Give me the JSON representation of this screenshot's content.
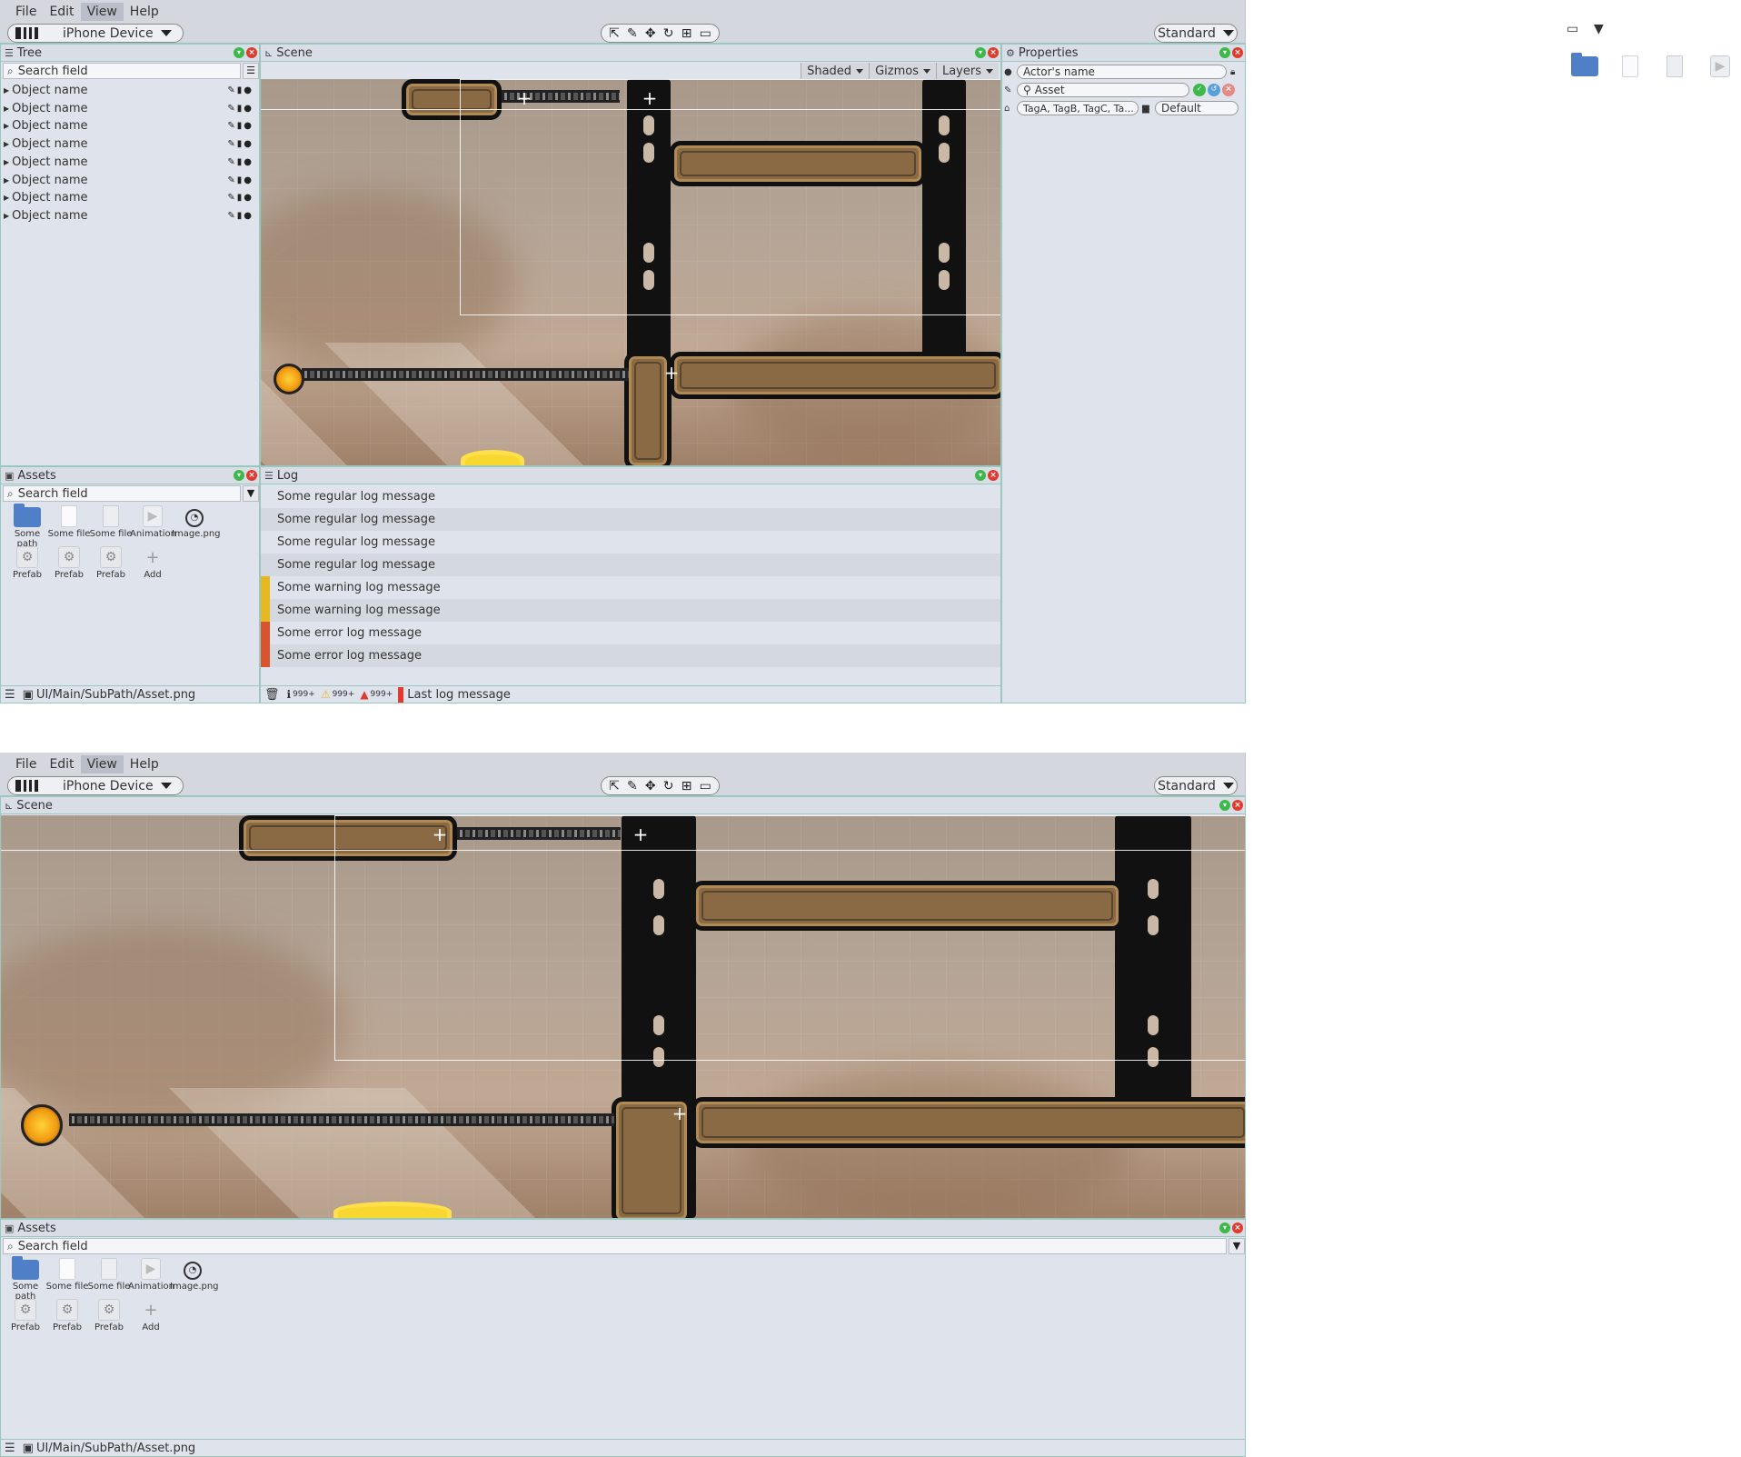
{
  "menu": [
    "File",
    "Edit",
    "View",
    "Help"
  ],
  "menu_active": "View",
  "toolbar": {
    "device": "iPhone Device",
    "tools": [
      "select-tool",
      "pen-tool",
      "move-tool",
      "rotate-tool",
      "scale-tool",
      "rect-tool"
    ],
    "tool_glyphs": [
      "⇱",
      "✎",
      "✥",
      "↻",
      "⊞",
      "▭"
    ],
    "layout": "Standard"
  },
  "tree": {
    "title": "Tree",
    "search_placeholder": "Search field",
    "items": [
      "Object name",
      "Object name",
      "Object name",
      "Object name",
      "Object name",
      "Object name",
      "Object name",
      "Object name"
    ]
  },
  "scene": {
    "title": "Scene",
    "dropdowns": [
      "Shaded",
      "Gizmos",
      "Layers"
    ]
  },
  "properties": {
    "title": "Properties",
    "actor_name": "Actor's name",
    "asset": "Asset",
    "tags": "TagA, TagB, TagC, Ta...",
    "layer": "Default"
  },
  "assets": {
    "title": "Assets",
    "search_placeholder": "Search field",
    "row1": [
      {
        "label": "Some path",
        "icon": "folder-icon"
      },
      {
        "label": "Some file",
        "icon": "file-icon"
      },
      {
        "label": "Some file",
        "icon": "text-file-icon"
      },
      {
        "label": "Animation",
        "icon": "animation-icon"
      },
      {
        "label": "Image.png",
        "icon": "image-icon"
      }
    ],
    "row2": [
      {
        "label": "Prefab",
        "icon": "prefab-icon"
      },
      {
        "label": "Prefab",
        "icon": "prefab-icon"
      },
      {
        "label": "Prefab",
        "icon": "prefab-icon"
      },
      {
        "label": "Add",
        "icon": "add-icon"
      }
    ],
    "path": "UI/Main/SubPath/Asset.png"
  },
  "log": {
    "title": "Log",
    "rows": [
      {
        "text": "Some regular log message",
        "level": "regular"
      },
      {
        "text": "Some regular log message",
        "level": "regular"
      },
      {
        "text": "Some regular log message",
        "level": "regular"
      },
      {
        "text": "Some regular log message",
        "level": "regular"
      },
      {
        "text": "Some warning log message",
        "level": "warning"
      },
      {
        "text": "Some warning log message",
        "level": "warning"
      },
      {
        "text": "Some error log message",
        "level": "error"
      },
      {
        "text": "Some error log message",
        "level": "error"
      }
    ],
    "info_count": "999+",
    "warning_count": "999+",
    "error_count": "999+",
    "last_message": "Last log message"
  },
  "colors": {
    "panel_border": "#9ac8be",
    "warning": "#e8b820",
    "error": "#d9542e",
    "close": "#e23a2e",
    "minimize": "#3db84a"
  }
}
